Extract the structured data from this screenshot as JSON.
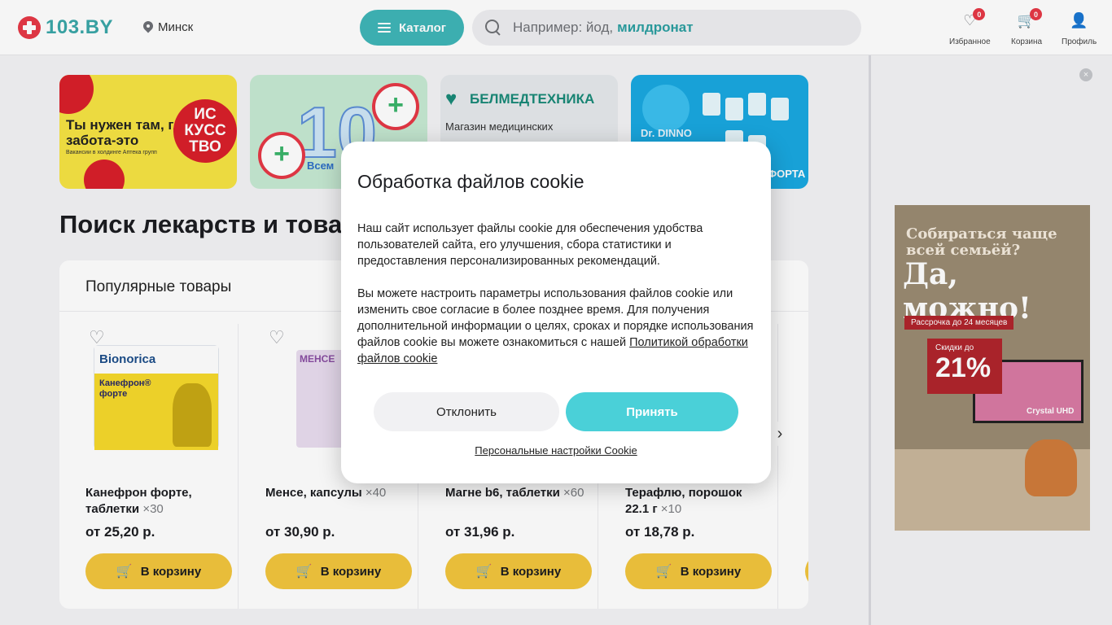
{
  "header": {
    "logo_text": "103.BY",
    "city": "Минск",
    "catalog_label": "Каталог",
    "search_placeholder": "Например: йод,",
    "search_hint": "милдронат",
    "favorites_label": "Избранное",
    "favorites_count": "0",
    "cart_label": "Корзина",
    "cart_count": "0",
    "profile_label": "Профиль"
  },
  "banners": [
    {
      "headline": "Ты нужен там, где забота-это",
      "sub": "Вакансии в холдинге Аптека групп",
      "badge": "ИС КУСС ТВО"
    },
    {
      "number": "10",
      "text": "Всем"
    },
    {
      "brand": "БЕЛМЕДТЕХНИКА",
      "text": "Магазин медицинских"
    },
    {
      "brand": "Dr. DINNO",
      "text": "ФОРТА"
    }
  ],
  "main": {
    "section_title": "Поиск лекарств и товаров",
    "popular_title": "Популярные товары"
  },
  "products": [
    {
      "name": "Канефрон форте, таблетки",
      "qty": "×30",
      "price": "от 25,20 р.",
      "cart_label": "В корзину",
      "img_brand": "Bionorica",
      "img_name": "Канефрон® форте"
    },
    {
      "name": "Менсе, капсулы",
      "qty": "×40",
      "price": "от 30,90 р.",
      "cart_label": "В корзину",
      "img_brand": "МЕНСЕ"
    },
    {
      "name": "Магне b6, таблетки",
      "qty": "×60",
      "price": "от 31,96 р.",
      "cart_label": "В корзину"
    },
    {
      "name": "Терафлю, порошок 22.1 г",
      "qty": "×10",
      "price": "от 18,78 р.",
      "cart_label": "В корзину"
    }
  ],
  "ad": {
    "line1": "Собираться чаще всей семьёй?",
    "line2": "Да, можно!",
    "installment": "Рассрочка до 24 месяцев",
    "discount_label": "Скидки до",
    "discount_value": "21%",
    "tv_label": "Crystal UHD"
  },
  "cookie": {
    "title": "Обработка файлов cookie",
    "paragraph1": "Наш сайт использует файлы cookie для обеспечения удобства пользователей сайта, его улучшения, сбора статистики и предоставления персонализированных рекомендаций.",
    "paragraph2": "Вы можете настроить параметры использования файлов cookie или изменить свое согласие в более позднее время. Для получения дополнительной информации о целях, сроках и порядке использования файлов cookie вы можете ознакомиться с нашей",
    "policy_link": "Политикой обработки файлов cookie",
    "decline_label": "Отклонить",
    "accept_label": "Принять",
    "settings_label": "Персональные настройки Cookie"
  }
}
